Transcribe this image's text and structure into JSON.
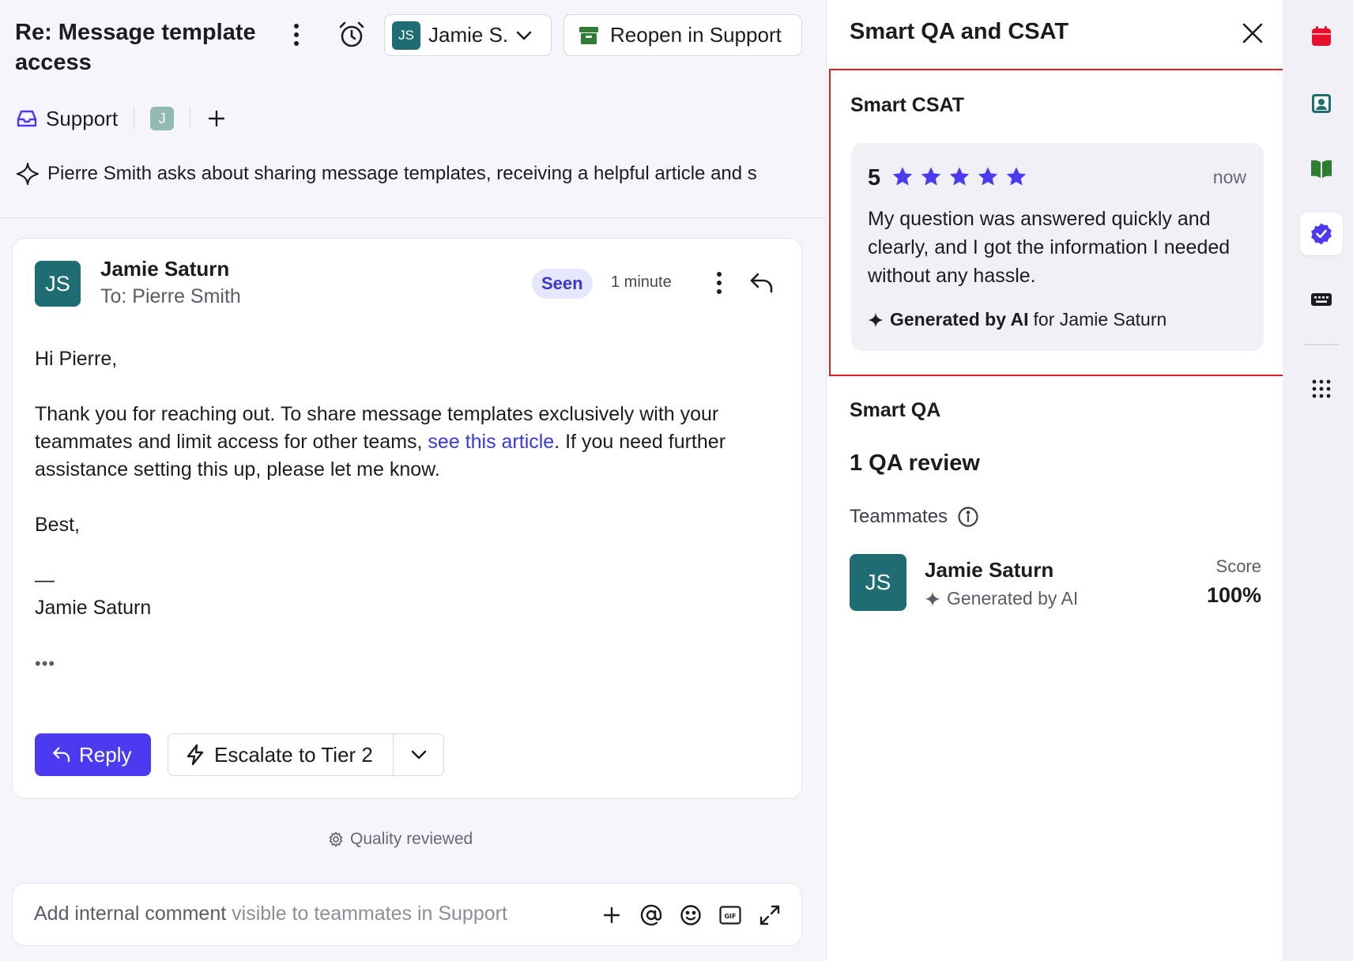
{
  "conversation": {
    "title": "Re: Message template access",
    "assignee": {
      "initials": "JS",
      "name": "Jamie S."
    },
    "reopen_label": "Reopen in Support",
    "inbox_label": "Support",
    "participant_initial": "J",
    "summary": "Pierre Smith asks about sharing message templates, receiving a helpful article and s"
  },
  "message": {
    "avatar_initials": "JS",
    "sender": "Jamie Saturn",
    "to": "To: Pierre Smith",
    "seen_label": "Seen",
    "time": "1 minute",
    "greeting": "Hi Pierre,",
    "body_before_link": "Thank you for reaching out. To share message templates exclusively with your teammates and limit access for other teams, ",
    "link_text": "see this article",
    "body_after_link": ". If you need further assistance setting this up, please let me know.",
    "signoff": "Best,",
    "dash": "—",
    "signature": "Jamie Saturn",
    "more": "•••",
    "reply_label": "Reply",
    "escalate_label": "Escalate to Tier 2"
  },
  "quality_reviewed": "Quality reviewed",
  "comment": {
    "placeholder_main": "Add internal comment",
    "placeholder_dim": " visible to teammates in Support"
  },
  "panel": {
    "title": "Smart QA and CSAT",
    "csat": {
      "heading": "Smart CSAT",
      "score": "5",
      "stars": 5,
      "time": "now",
      "comment": "My question was answered quickly and clearly, and I got the information I needed without any hassle.",
      "generated_bold": "Generated by AI",
      "generated_rest": "for Jamie Saturn"
    },
    "qa": {
      "heading": "Smart QA",
      "count": "1 QA review",
      "teammates_label": "Teammates",
      "teammate": {
        "initials": "JS",
        "name": "Jamie Saturn",
        "generated": "Generated by AI",
        "score_label": "Score",
        "score": "100%"
      }
    }
  },
  "colors": {
    "accent": "#4b3af0",
    "avatar_teal": "#1f6d72",
    "highlight_border": "#e02020",
    "calendar_red": "#e5102a",
    "contact_teal": "#1f6d72",
    "book_green": "#2e7d32"
  }
}
